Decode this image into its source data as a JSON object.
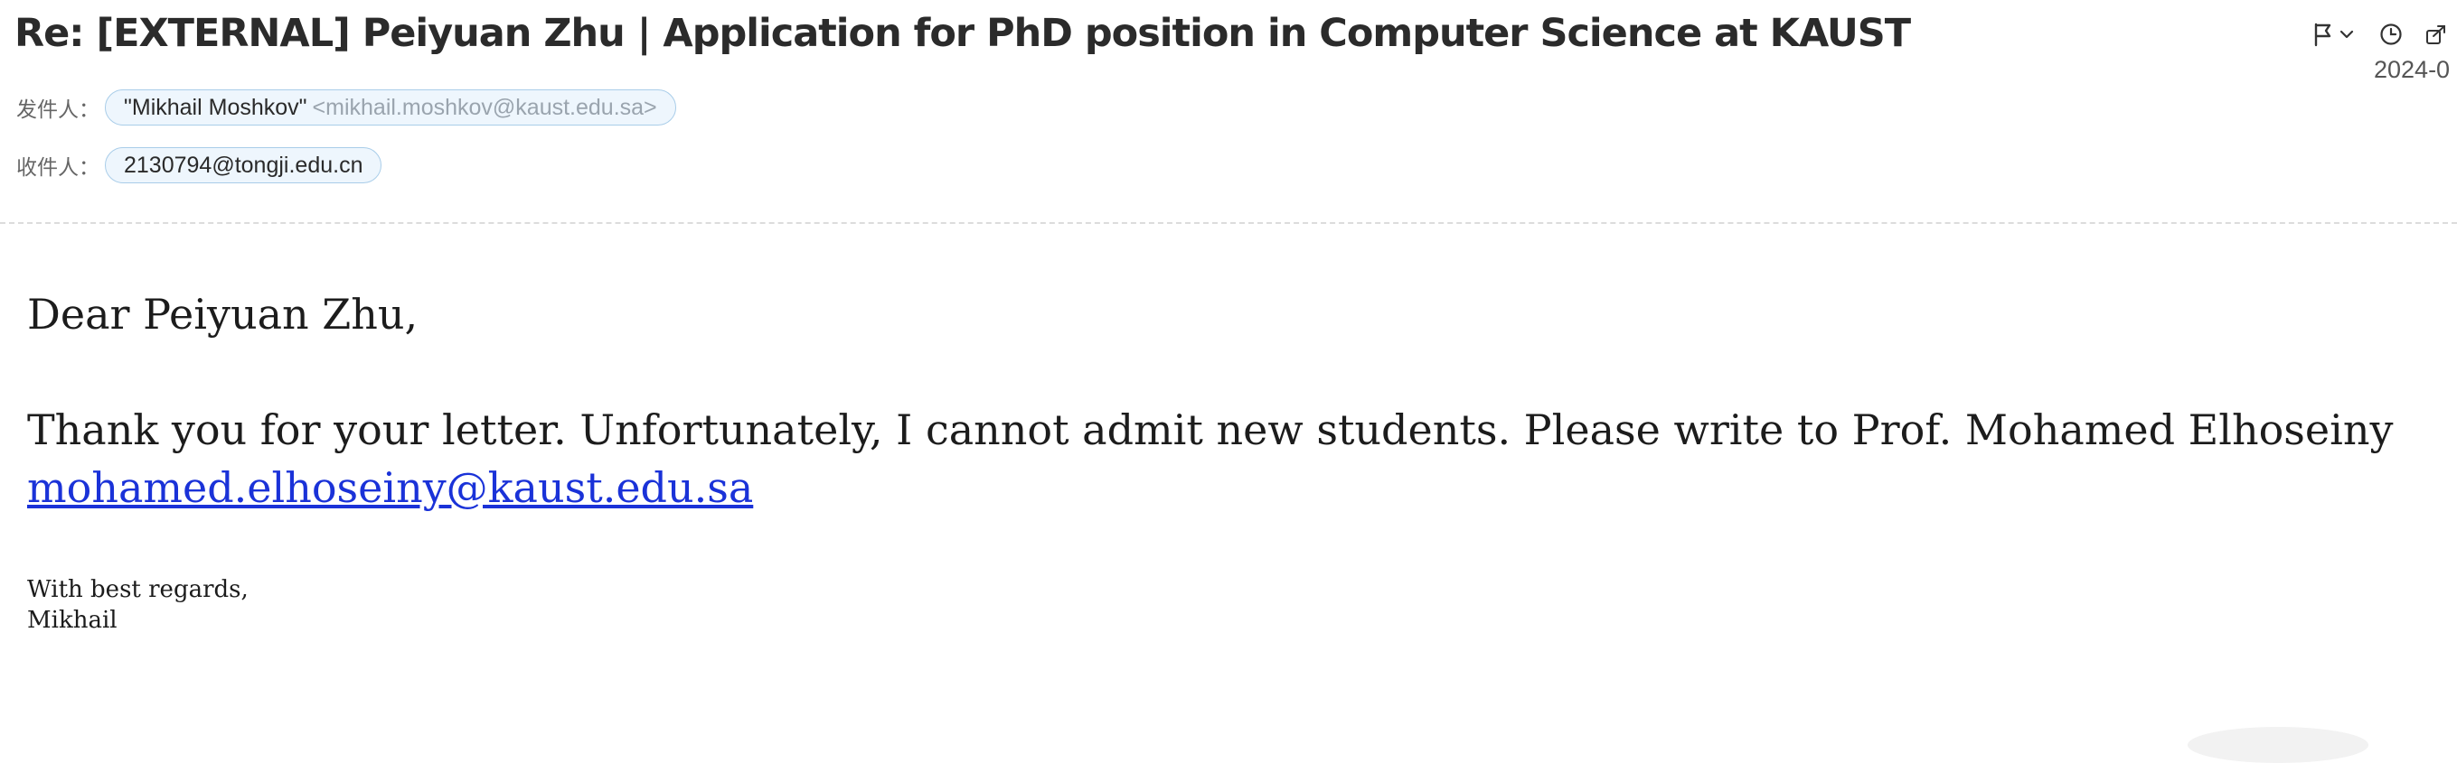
{
  "email": {
    "subject": "Re: [EXTERNAL] Peiyuan Zhu | Application for PhD position in Computer Science at KAUST",
    "date": "2024-0",
    "from": {
      "label": "发件人：",
      "name": "\"Mikhail Moshkov\"",
      "address": "<mikhail.moshkov@kaust.edu.sa>"
    },
    "to": {
      "label": "收件人：",
      "address": "2130794@tongji.edu.cn"
    },
    "body": {
      "greeting": "Dear Peiyuan Zhu,",
      "paragraph": "Thank you for your letter. Unfortunately, I cannot admit new students. Please write to Prof. Mohamed Elhoseiny",
      "link": "mohamed.elhoseiny@kaust.edu.sa",
      "closing": "With best regards,",
      "signature": "Mikhail"
    }
  },
  "toolbar": {
    "icons": [
      "flag-icon",
      "chevron-down-icon",
      "clock-icon",
      "share-icon"
    ]
  },
  "colors": {
    "chip_border": "#a9cde9",
    "chip_bg": "#eef6fd",
    "link": "#1a32d8"
  }
}
